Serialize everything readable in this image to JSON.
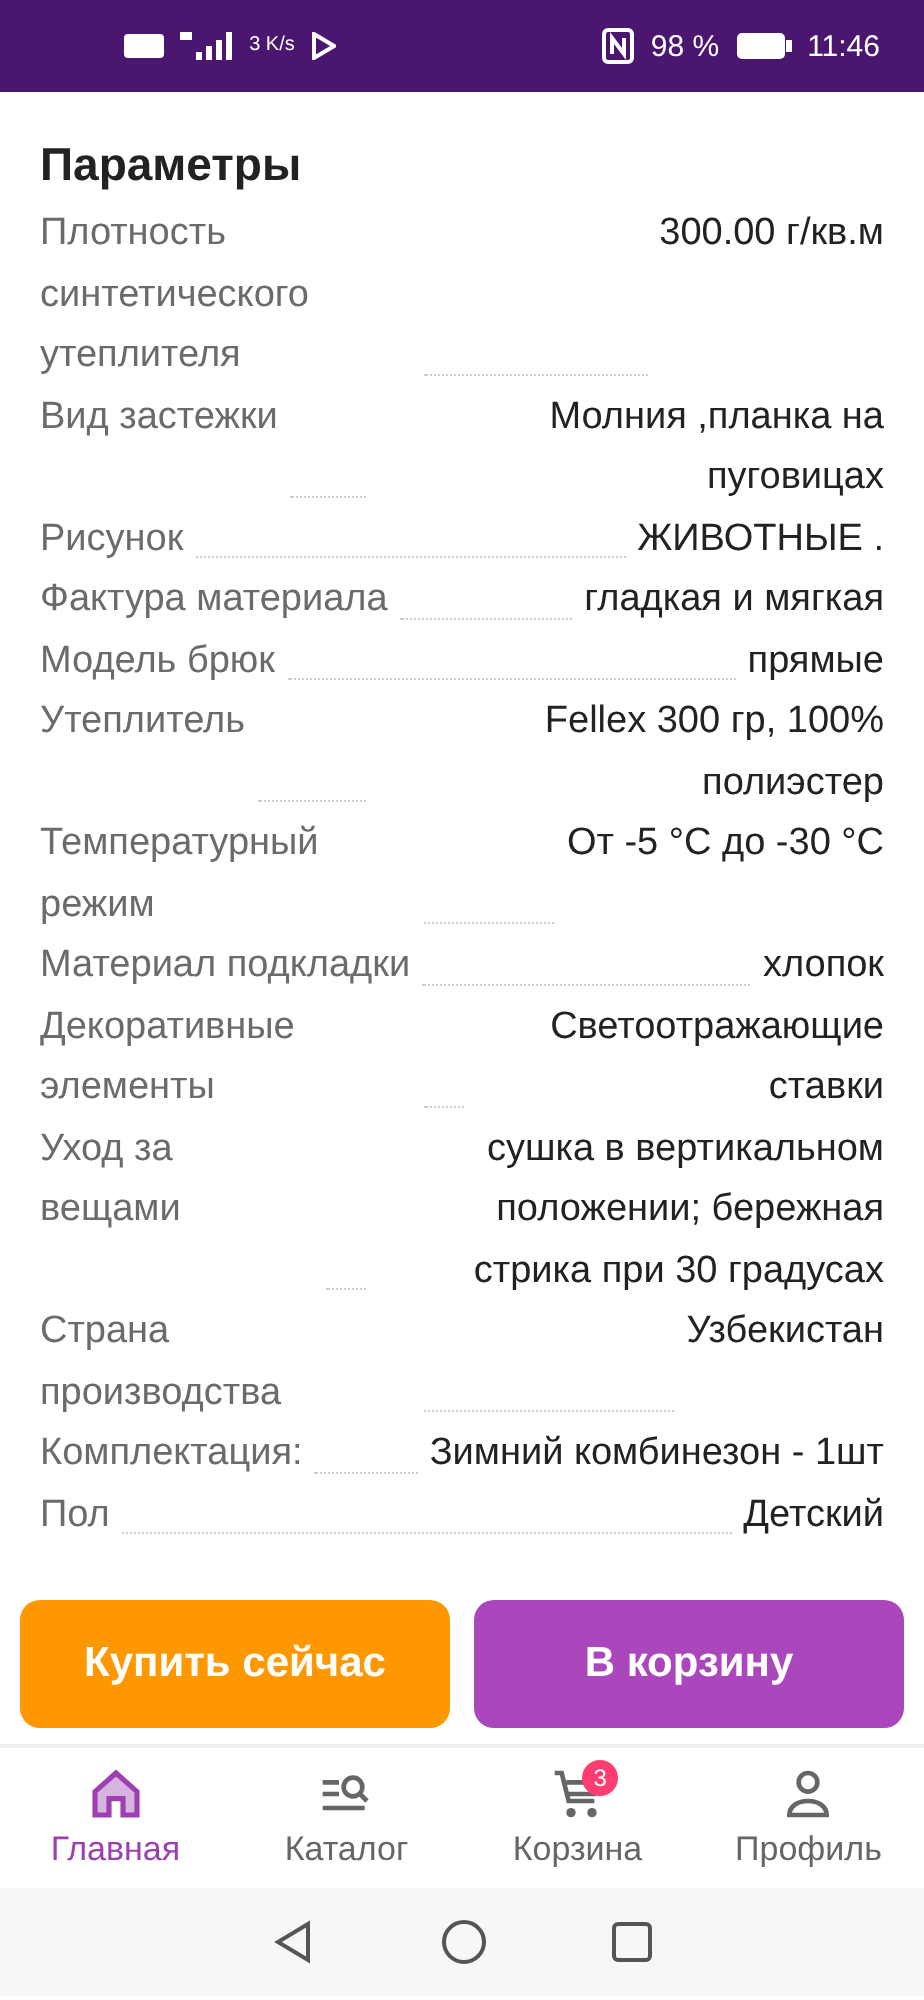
{
  "status_bar": {
    "speed": "3 K/s",
    "battery": "98 %",
    "time": "11:46"
  },
  "section_title": "Параметры",
  "params": [
    {
      "label": "Плотность синтетического утеплителя",
      "value": "300.00 г/кв.м"
    },
    {
      "label": "Вид застежки",
      "value": "Молния ,планка на пуговицах"
    },
    {
      "label": "Рисунок",
      "value": "ЖИВОТНЫЕ ."
    },
    {
      "label": "Фактура материала",
      "value": "гладкая и мягкая"
    },
    {
      "label": "Модель брюк",
      "value": "прямые"
    },
    {
      "label": "Утеплитель",
      "value": "Fellex 300 гр, 100% полиэстер"
    },
    {
      "label": "Температурный режим",
      "value": "От -5 °С до -30 °С"
    },
    {
      "label": "Материал подкладки",
      "value": "хлопок"
    },
    {
      "label": "Декоративные элементы",
      "value": "Светоотражающие ставки"
    },
    {
      "label": "Уход за вещами",
      "value": "сушка в вертикальном положении; бережная стрика при 30 градусах"
    },
    {
      "label": "Страна производства",
      "value": "Узбекистан"
    },
    {
      "label": "Комплектация:",
      "value": "Зимний комбинезон - 1шт"
    },
    {
      "label": "Пол",
      "value": "Детский"
    }
  ],
  "actions": [
    {
      "kind": "buy",
      "label": "Купить сейчас"
    },
    {
      "kind": "cart",
      "label": "В корзину"
    }
  ],
  "nav": [
    {
      "kind": "home",
      "label": "Главная",
      "selected": true
    },
    {
      "kind": "catalog",
      "label": "Каталог",
      "selected": false
    },
    {
      "kind": "cart",
      "label": "Корзина",
      "selected": false,
      "badge": "3"
    },
    {
      "kind": "profile",
      "label": "Профиль",
      "selected": false
    }
  ]
}
